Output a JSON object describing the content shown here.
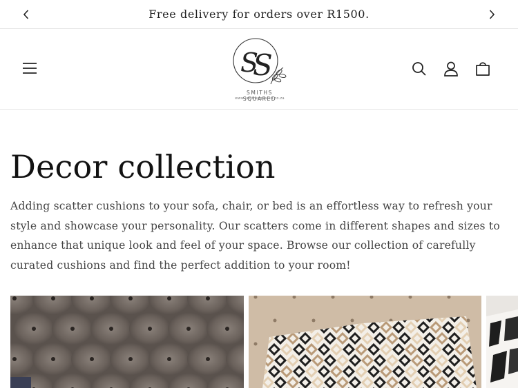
{
  "announcement": {
    "text": "Free delivery for orders over R1500.",
    "prev_icon": "chevron-left-icon",
    "next_icon": "chevron-right-icon"
  },
  "header": {
    "menu_icon": "menu-icon",
    "logo": {
      "monogram": "SS",
      "brand_name": "SMITHS SQUARED",
      "url": "www.smithssquared.co.za"
    },
    "icons": [
      "search-icon",
      "account-icon",
      "cart-icon"
    ]
  },
  "collection": {
    "title": "Decor collection",
    "description": "Adding scatter cushions to your sofa, chair, or bed is an effortless way to refresh your style and showcase your personality. Our scatters come in different shapes and sizes to enhance that unique look and feel of your space. Browse our collection of carefully curated cushions and find the perfect addition to your room!"
  },
  "products": [
    {
      "image": "tufted-brown-velvet-headboard-photo"
    },
    {
      "image": "geometric-diamond-pattern-cushion-photo"
    },
    {
      "image": "black-white-cushion-photo-partial"
    }
  ],
  "colors": {
    "text": "#121212",
    "body_text": "#444444",
    "border": "#e6e6e6",
    "background": "#ffffff"
  }
}
